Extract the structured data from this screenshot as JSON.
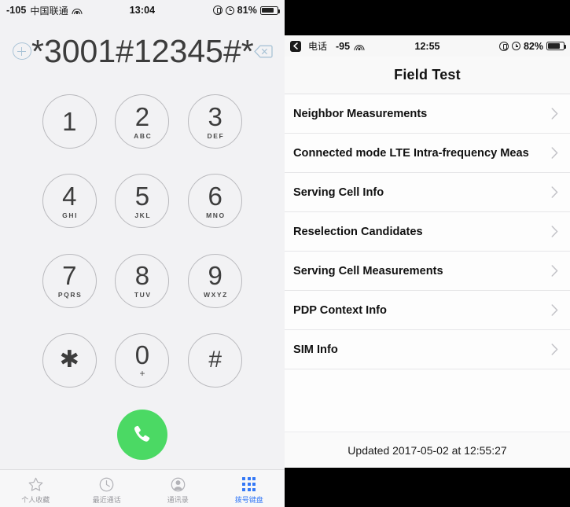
{
  "left": {
    "statusbar": {
      "rssi": "-105",
      "carrier": "中国联通",
      "wifi_icon": "wifi-icon",
      "time": "13:04",
      "rotation_lock_icon": "rotation-lock-icon",
      "alarm_icon": "alarm-clock-icon",
      "battery_percent": "81%",
      "battery_icon": "battery-icon"
    },
    "dial": {
      "add_contact_icon": "add-contact-icon",
      "number": "*3001#12345#*",
      "backspace_icon": "backspace-icon"
    },
    "keypad": [
      {
        "digit": "1",
        "letters": ""
      },
      {
        "digit": "2",
        "letters": "ABC"
      },
      {
        "digit": "3",
        "letters": "DEF"
      },
      {
        "digit": "4",
        "letters": "GHI"
      },
      {
        "digit": "5",
        "letters": "JKL"
      },
      {
        "digit": "6",
        "letters": "MNO"
      },
      {
        "digit": "7",
        "letters": "PQRS"
      },
      {
        "digit": "8",
        "letters": "TUV"
      },
      {
        "digit": "9",
        "letters": "WXYZ"
      },
      {
        "digit": "✱",
        "letters": ""
      },
      {
        "digit": "0",
        "letters": "+"
      },
      {
        "digit": "#",
        "letters": ""
      }
    ],
    "call_button": {
      "icon": "phone-call-icon",
      "color": "#4bd964"
    },
    "tabs": [
      {
        "label": "个人收藏",
        "icon": "star-icon",
        "active": false
      },
      {
        "label": "最近通话",
        "icon": "clock-icon",
        "active": false
      },
      {
        "label": "通讯录",
        "icon": "person-icon",
        "active": false
      },
      {
        "label": "拨号键盘",
        "icon": "keypad-grid-icon",
        "active": true
      }
    ],
    "accent_color": "#3478f6"
  },
  "right": {
    "statusbar": {
      "back_icon": "back-arrow-icon",
      "back_label": "电话",
      "rssi": "-95",
      "wifi_icon": "wifi-icon",
      "time": "12:55",
      "rotation_lock_icon": "rotation-lock-icon",
      "alarm_icon": "alarm-clock-icon",
      "battery_percent": "82%",
      "battery_icon": "battery-icon"
    },
    "title": "Field Test",
    "rows": [
      {
        "label": "Neighbor Measurements",
        "chevron_icon": "chevron-right-icon"
      },
      {
        "label": "Connected mode LTE Intra-frequency Meas",
        "chevron_icon": "chevron-right-icon"
      },
      {
        "label": "Serving Cell Info",
        "chevron_icon": "chevron-right-icon"
      },
      {
        "label": "Reselection Candidates",
        "chevron_icon": "chevron-right-icon"
      },
      {
        "label": "Serving Cell Measurements",
        "chevron_icon": "chevron-right-icon"
      },
      {
        "label": "PDP Context Info",
        "chevron_icon": "chevron-right-icon"
      },
      {
        "label": "SIM Info",
        "chevron_icon": "chevron-right-icon"
      }
    ],
    "footer": "Updated 2017-05-02 at 12:55:27"
  }
}
